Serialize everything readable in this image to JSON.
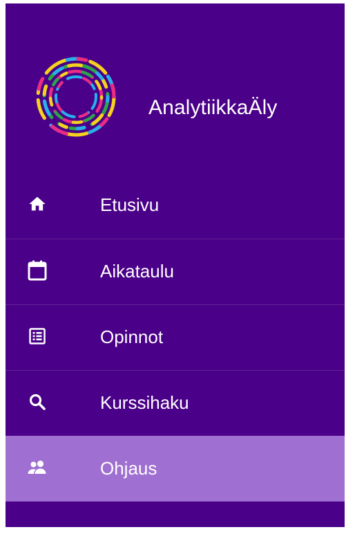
{
  "brand": {
    "app_name": "AnalytiikkaÄly",
    "logo_icon": "circular-dashed-rings-logo"
  },
  "nav": {
    "items": [
      {
        "label": "Etusivu",
        "icon": "home-icon",
        "active": false
      },
      {
        "label": "Aikataulu",
        "icon": "calendar-icon",
        "active": false
      },
      {
        "label": "Opinnot",
        "icon": "list-icon",
        "active": false
      },
      {
        "label": "Kurssihaku",
        "icon": "search-icon",
        "active": false
      },
      {
        "label": "Ohjaus",
        "icon": "people-icon",
        "active": true
      }
    ]
  },
  "colors": {
    "sidebar_background": "#4a0088",
    "active_item_background": "#9f6fd1",
    "text": "#ffffff"
  }
}
